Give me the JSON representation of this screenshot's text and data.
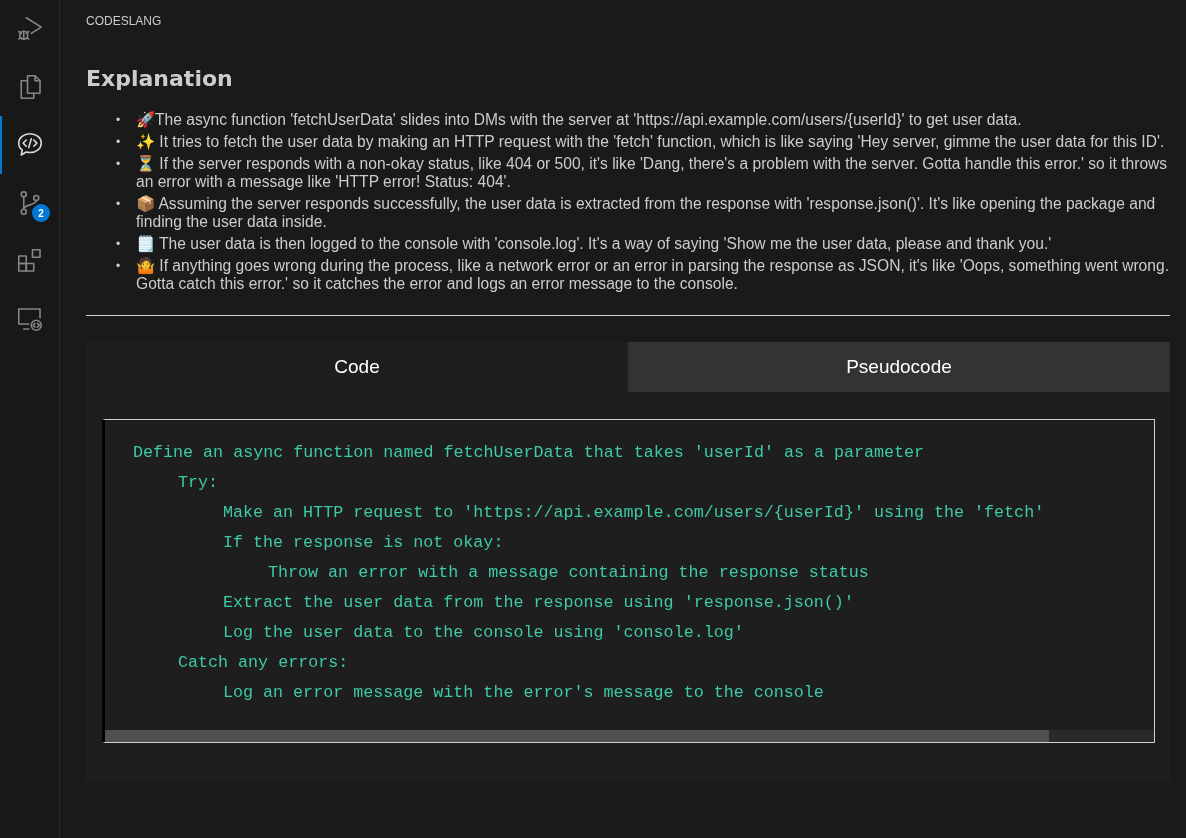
{
  "activity_bar": [
    {
      "kind": "debug",
      "selected": false
    },
    {
      "kind": "files",
      "selected": false
    },
    {
      "kind": "chat",
      "selected": true
    },
    {
      "kind": "branch",
      "selected": false,
      "badge": "2"
    },
    {
      "kind": "extensions",
      "selected": false
    },
    {
      "kind": "remote",
      "selected": false
    }
  ],
  "bullet_marker": "•",
  "panel_title": "CODESLANG",
  "heading": "Explanation",
  "bullets": [
    "🚀The async function 'fetchUserData' slides into DMs with the server at 'https://api.example.com/users/{userId}' to get user data.",
    "✨ It tries to fetch the user data by making an HTTP request with the 'fetch' function, which is like saying 'Hey server, gimme the user data for this ID'.",
    "⏳ If the server responds with a non-okay status, like 404 or 500, it's like 'Dang, there's a problem with the server. Gotta handle this error.' so it throws an error with a message like 'HTTP error! Status: 404'.",
    "📦 Assuming the server responds successfully, the user data is extracted from the response with 'response.json()'. It's like opening the package and finding the user data inside.",
    "🗒️ The user data is then logged to the console with 'console.log'. It's a way of saying 'Show me the user data, please and thank you.'",
    "🤷 If anything goes wrong during the process, like a network error or an error in parsing the response as JSON, it's like 'Oops, something went wrong. Gotta catch this error.' so it catches the error and logs an error message to the console."
  ],
  "tabs": [
    {
      "label": "Code",
      "selected": false
    },
    {
      "label": "Pseudocode",
      "selected": true
    }
  ],
  "code_lines": [
    {
      "text": "Define an async function named fetchUserData that takes 'userId' as a parameter",
      "children": [
        {
          "text": "Try:",
          "children": [
            {
              "text": "Make an HTTP request to 'https://api.example.com/users/{userId}' using the 'fetch'"
            },
            {
              "text": "If the response is not okay:",
              "children": [
                {
                  "text": "Throw an error with a message containing the response status"
                }
              ]
            },
            {
              "text": "Extract the user data from the response using 'response.json()'"
            },
            {
              "text": "Log the user data to the console using 'console.log'"
            }
          ]
        },
        {
          "text": "Catch any errors:",
          "children": [
            {
              "text": "Log an error message with the error's message to the console"
            }
          ]
        }
      ]
    }
  ]
}
